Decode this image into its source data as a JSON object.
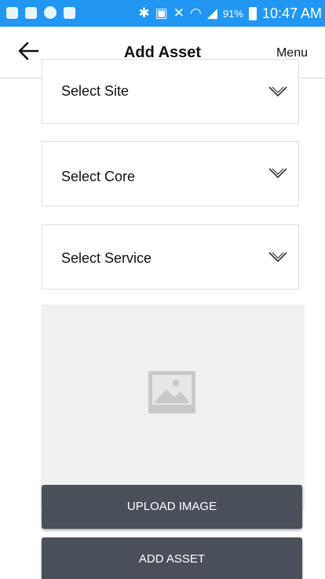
{
  "status_bar": {
    "time": "10:47 AM",
    "battery": "91%",
    "icons": [
      "add-icon",
      "image-icon",
      "lock-icon",
      "close-box-icon",
      "bluetooth-icon",
      "nfc-icon",
      "mute-icon",
      "wifi-icon",
      "signal-icon",
      "battery-icon"
    ]
  },
  "app_bar": {
    "title": "Add Asset",
    "menu_label": "Menu",
    "back_icon": "arrow-left-icon"
  },
  "form": {
    "site_label": "Select Site",
    "core_label": "Select Core",
    "service_label": "Select Service"
  },
  "image": {
    "placeholder_icon": "image-placeholder-icon"
  },
  "actions": {
    "upload_label": "UPLOAD IMAGE",
    "add_label": "ADD ASSET"
  },
  "colors": {
    "status_bar": "#2196f3",
    "button": "#4a505a",
    "panel": "#f0f0f0"
  }
}
